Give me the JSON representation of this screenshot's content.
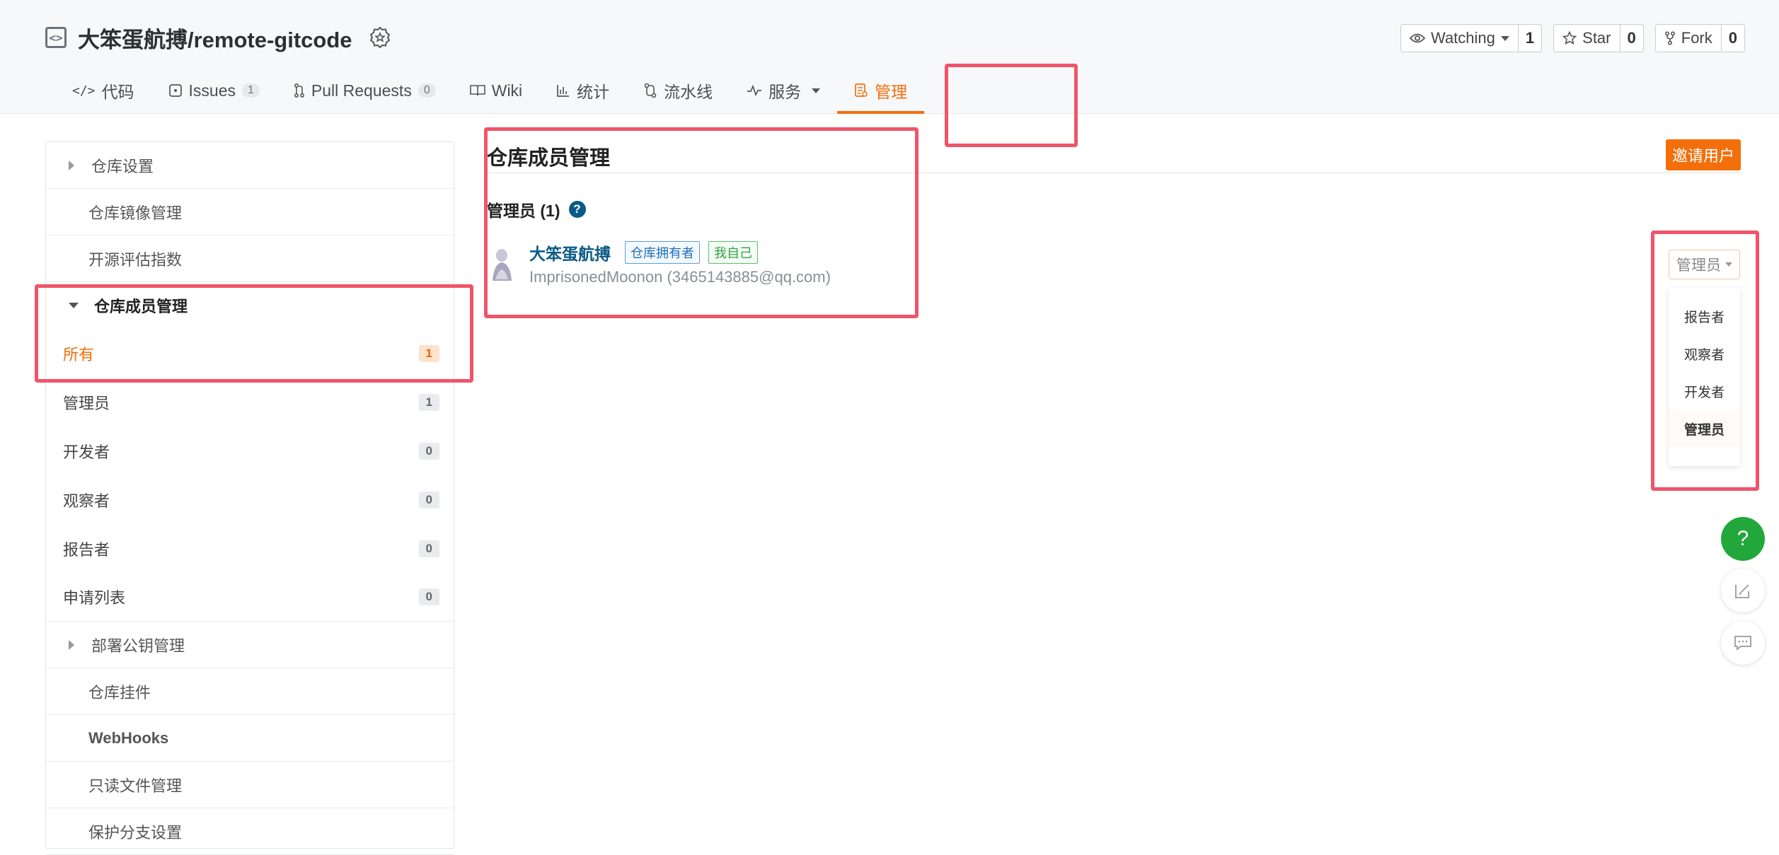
{
  "repo": {
    "full_name": "大笨蛋航搏/remote-gitcode"
  },
  "actions": [
    {
      "label": "Watching",
      "count": "1"
    },
    {
      "label": "Star",
      "count": "0"
    },
    {
      "label": "Fork",
      "count": "0"
    }
  ],
  "tabs": [
    {
      "label": "代码"
    },
    {
      "label": "Issues",
      "count": "1"
    },
    {
      "label": "Pull Requests",
      "count": "0"
    },
    {
      "label": "Wiki"
    },
    {
      "label": "统计"
    },
    {
      "label": "流水线"
    },
    {
      "label": "服务"
    },
    {
      "label": "管理"
    }
  ],
  "sidebar": {
    "repo_settings": "仓库设置",
    "mirror": "仓库镜像管理",
    "oss_index": "开源评估指数",
    "members": "仓库成员管理",
    "member_items": [
      {
        "label": "所有",
        "count": "1"
      },
      {
        "label": "管理员",
        "count": "1"
      },
      {
        "label": "开发者",
        "count": "0"
      },
      {
        "label": "观察者",
        "count": "0"
      },
      {
        "label": "报告者",
        "count": "0"
      },
      {
        "label": "申请列表",
        "count": "0"
      }
    ],
    "deploy_keys": "部署公钥管理",
    "widgets": "仓库挂件",
    "webhooks": "WebHooks",
    "readonly_files": "只读文件管理",
    "protected_branches": "保护分支设置"
  },
  "main": {
    "title": "仓库成员管理",
    "invite_label": "邀请用户",
    "section_title": "管理员 (1)",
    "member": {
      "name": "大笨蛋航搏",
      "tag_owner": "仓库拥有者",
      "tag_me": "我自己",
      "subtitle": "ImprisonedMoonon (3465143885@qq.com)"
    },
    "role_select": {
      "value": "管理员",
      "options": [
        "报告者",
        "观察者",
        "开发者",
        "管理员"
      ]
    }
  },
  "colors": {
    "accent": "#f36f0c",
    "link": "#0b5b86",
    "annotation": "#f0546a",
    "help": "#22a83a"
  }
}
